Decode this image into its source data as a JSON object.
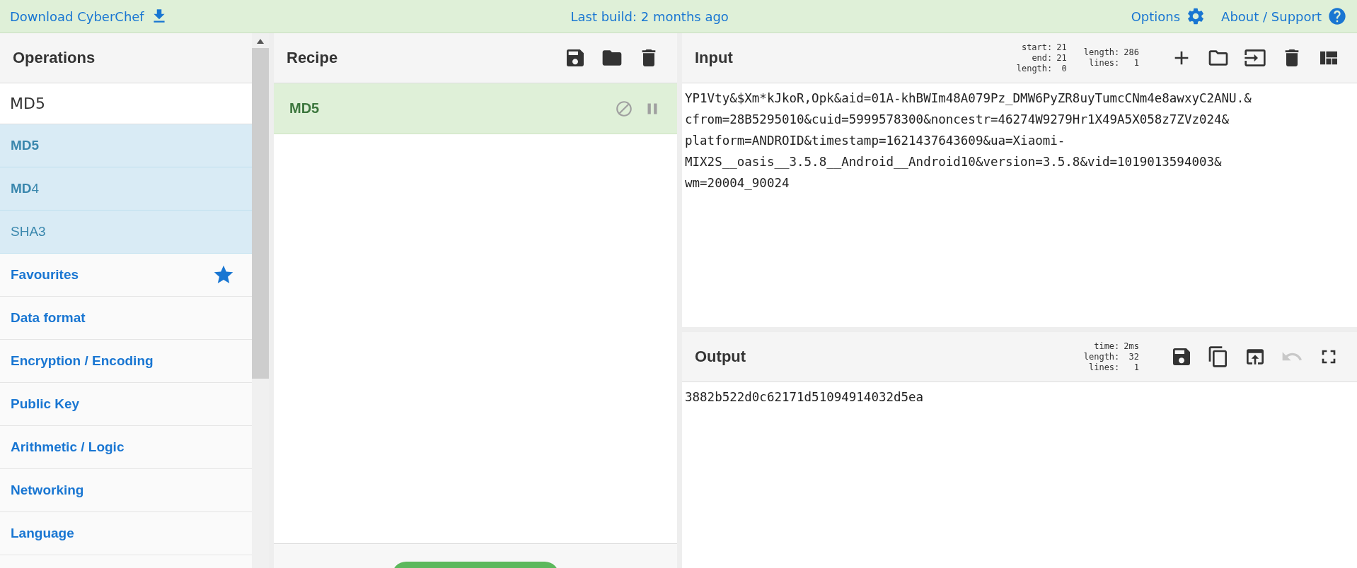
{
  "top_bar": {
    "download": "Download CyberChef",
    "build": "Last build: 2 months ago",
    "options": "Options",
    "about": "About / Support"
  },
  "operations": {
    "title": "Operations",
    "search_value": "MD5",
    "results": [
      {
        "label": "**MD5**"
      },
      {
        "label": "**MD**4"
      },
      {
        "label": "SHA3"
      }
    ],
    "categories": [
      {
        "label": "Favourites",
        "kind": "favourites"
      },
      {
        "label": "Data format",
        "kind": "plain"
      },
      {
        "label": "Encryption / Encoding",
        "kind": "plain"
      },
      {
        "label": "Public Key",
        "kind": "plain"
      },
      {
        "label": "Arithmetic / Logic",
        "kind": "plain"
      },
      {
        "label": "Networking",
        "kind": "plain"
      },
      {
        "label": "Language",
        "kind": "plain"
      }
    ]
  },
  "recipe": {
    "title": "Recipe",
    "buttons": [
      {
        "kind": "save"
      },
      {
        "kind": "load"
      },
      {
        "kind": "clear"
      }
    ],
    "steps": [
      {
        "name": "MD5",
        "disabled": false,
        "paused": false
      }
    ]
  },
  "input": {
    "title": "Input",
    "stats": [
      [
        {
          "label": "start:",
          "value": "21"
        },
        {
          "label": "end:",
          "value": "21"
        },
        {
          "label": "length:",
          "value": "0"
        }
      ],
      [
        {
          "label": "length:",
          "value": "286"
        },
        {
          "label": "lines:",
          "value": "1"
        }
      ]
    ],
    "buttons": [
      {
        "kind": "add",
        "disabled": false
      },
      {
        "kind": "open",
        "disabled": false
      },
      {
        "kind": "import",
        "disabled": false
      },
      {
        "kind": "clear",
        "disabled": false
      },
      {
        "kind": "layout",
        "disabled": false
      }
    ],
    "lines": [
      "YP1Vty&$Xm*kJkoR,Opk&aid=01A-khBWIm48A079Pz_DMW6PyZR8uyTumcCNm4e8awxyC2ANU.&",
      "cfrom=28B5295010&cuid=5999578300&noncestr=46274W9279Hr1X49A5X058z7ZVz024&",
      "platform=ANDROID&timestamp=1621437643609&ua=Xiaomi-",
      "MIX2S__oasis__3.5.8__Android__Android10&version=3.5.8&vid=1019013594003&",
      "wm=20004_90024"
    ]
  },
  "output": {
    "title": "Output",
    "stats": [
      [
        {
          "label": "time:",
          "value": "2ms"
        },
        {
          "label": "length:",
          "value": "32"
        },
        {
          "label": "lines:",
          "value": "1"
        }
      ]
    ],
    "buttons": [
      {
        "kind": "save",
        "disabled": false
      },
      {
        "kind": "copy",
        "disabled": false
      },
      {
        "kind": "replace",
        "disabled": false
      },
      {
        "kind": "undo",
        "disabled": true
      },
      {
        "kind": "maximise",
        "disabled": false
      }
    ],
    "value": "3882b522d0c62171d51094914032d5ea"
  }
}
